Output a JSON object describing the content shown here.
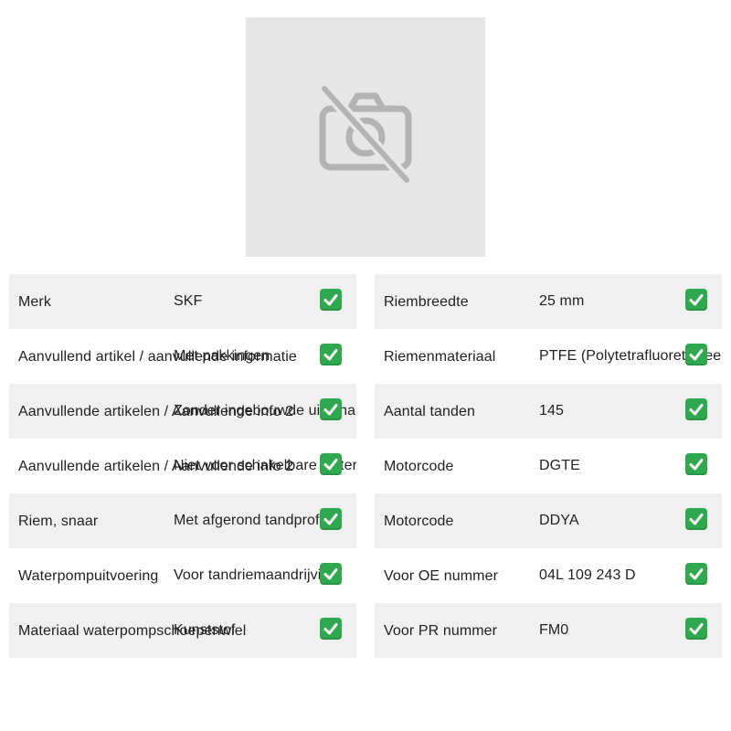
{
  "image_placeholder": {
    "icon": "no-camera-icon",
    "background": "#e6e6e6"
  },
  "colors": {
    "row_shaded": "#f0f0f0",
    "check_green": "#2fa84f"
  },
  "left_table": [
    {
      "label": "Merk",
      "value": "SKF"
    },
    {
      "label": "Aanvullend artikel / aanvullende informatie",
      "value": "Met pakkingen"
    },
    {
      "label": "Aanvullende artikelen / Aanvullende info 2",
      "value": "Zonder ingebouwde uitschakelaar"
    },
    {
      "label": "Aanvullende artikelen / Aanvullende info 2",
      "value": "Niet voor schakelbare waterpomp"
    },
    {
      "label": "Riem, snaar",
      "value": "Met afgerond tandprofiel"
    },
    {
      "label": "Waterpompuitvoering",
      "value": "Voor tandriemaandrijving"
    },
    {
      "label": "Materiaal waterpompschoepenwiel",
      "value": "Kunststof"
    }
  ],
  "right_table": [
    {
      "label": "Riembreedte",
      "value": "25 mm"
    },
    {
      "label": "Riemenmateriaal",
      "value": "PTFE (Polytetrafluorethyleen)"
    },
    {
      "label": "Aantal tanden",
      "value": "145"
    },
    {
      "label": "Motorcode",
      "value": "DGTE"
    },
    {
      "label": "Motorcode",
      "value": "DDYA"
    },
    {
      "label": "Voor OE nummer",
      "value": "04L 109 243 D"
    },
    {
      "label": "Voor PR nummer",
      "value": "FM0"
    }
  ],
  "status_icon": "check-mark-icon"
}
